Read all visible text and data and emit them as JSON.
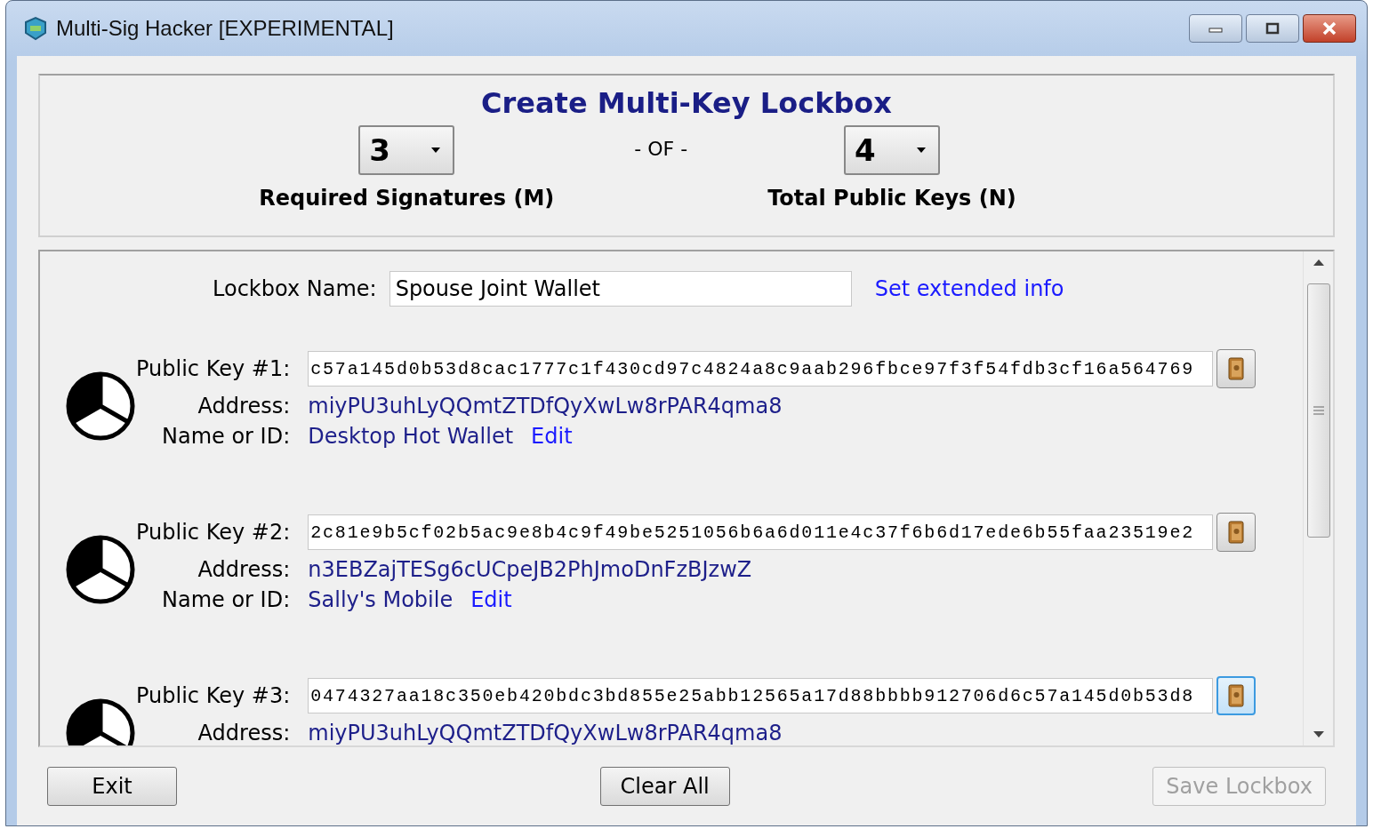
{
  "window": {
    "title": "Multi-Sig Hacker [EXPERIMENTAL]"
  },
  "header": {
    "title": "Create Multi-Key Lockbox",
    "m_value": "3",
    "separator": "- OF -",
    "n_value": "4",
    "m_label": "Required Signatures (M)",
    "n_label": "Total Public Keys (N)"
  },
  "lockbox_name": {
    "label": "Lockbox Name:",
    "value": "Spouse Joint Wallet",
    "link": "Set extended info"
  },
  "keys": [
    {
      "label": "Public Key #1:",
      "pubkey": "c57a145d0b53d8cac1777c1f430cd97c4824a8c9aab296fbce97f3f54fdb3cf16a564769",
      "address_label": "Address:",
      "address": "miyPU3uhLyQQmtZTDfQyXwLw8rPAR4qma8",
      "name_label": "Name or ID:",
      "name": "Desktop Hot Wallet",
      "edit": "Edit",
      "focused": false
    },
    {
      "label": "Public Key #2:",
      "pubkey": "2c81e9b5cf02b5ac9e8b4c9f49be5251056b6a6d011e4c37f6b6d17ede6b55faa23519e2",
      "address_label": "Address:",
      "address": "n3EBZajTESg6cUCpeJB2PhJmoDnFzBJzwZ",
      "name_label": "Name or ID:",
      "name": "Sally's Mobile",
      "edit": "Edit",
      "focused": false
    },
    {
      "label": "Public Key #3:",
      "pubkey": "0474327aa18c350eb420bdc3bd855e25abb12565a17d88bbbb912706d6c57a145d0b53d8",
      "address_label": "Address:",
      "address": "miyPU3uhLyQQmtZTDfQyXwLw8rPAR4qma8",
      "focused": true
    }
  ],
  "buttons": [
    {
      "label": "Exit",
      "disabled": false
    },
    {
      "label": "Clear All",
      "disabled": false
    },
    {
      "label": "Save Lockbox",
      "disabled": true
    }
  ]
}
